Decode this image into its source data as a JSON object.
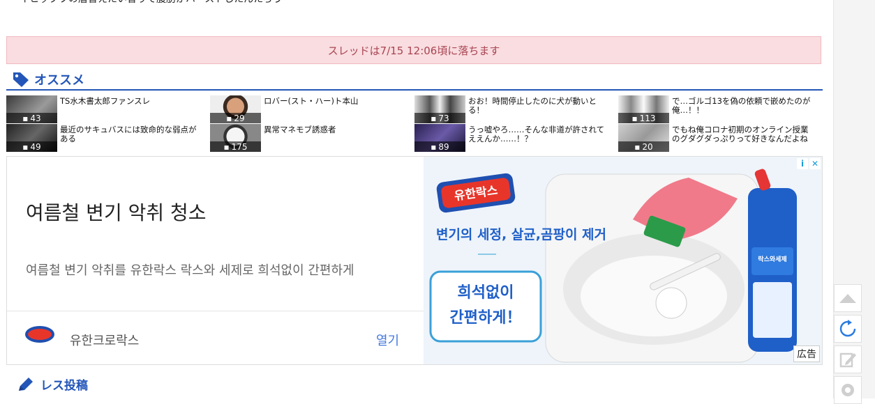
{
  "top_partial_text": "イヒックツの層替えたい智りで腹肪かハーストしたんたろう",
  "thread_notice": "スレッドは7/15 12:06頃に落ちます",
  "recommend": {
    "title": "オススメ",
    "items": [
      {
        "title": "TS水木書太郎ファンスレ",
        "count": "43"
      },
      {
        "title": "最近のサキュバスには致命的な弱点がある",
        "count": "49"
      },
      {
        "title": "ロバー(スト・ハー)ト本山",
        "count": "29"
      },
      {
        "title": "異常マネモブ誘惑者",
        "count": "175"
      },
      {
        "title": "おお！時間停止したのに犬が動いとる！",
        "count": "73"
      },
      {
        "title": "うっ嘘やろ……そんな非道が許されてええんか……！？",
        "count": "89"
      },
      {
        "title": "で…ゴルゴ13を偽の依頼で嵌めたのが俺…！！",
        "count": "113"
      },
      {
        "title": "でもね俺コロナ初期のオンライン授業のグダグダっぷりって好きなんだよね",
        "count": "20"
      }
    ]
  },
  "ad": {
    "headline": "여름철 변기 악취 청소",
    "description": "여름철 변기 악취를 유한락스 락스와 세제로 희석없이 간편하게",
    "advertiser": "유한크로락스",
    "open_label": "열기",
    "label": "広告",
    "image_brand": "유한락스",
    "image_tagline": "변기의 세정, 살균,곰팡이 제거",
    "image_callout_1": "희석없이",
    "image_callout_2": "간편하게！",
    "bottle_text": "락스와세제"
  },
  "post": {
    "title": "レス投稿"
  }
}
